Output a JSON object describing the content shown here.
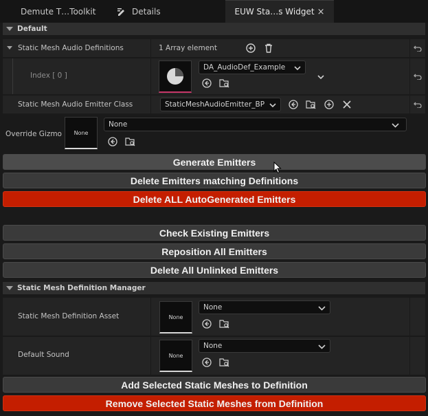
{
  "tabs": [
    {
      "label": "Demute T…Toolkit",
      "icon": "none"
    },
    {
      "label": "Details",
      "icon": "pencil-icon"
    },
    {
      "label": "EUW Sta…s Widget",
      "icon": "none",
      "close": "×"
    }
  ],
  "categories": {
    "default": "Default",
    "manager": "Static Mesh Definition Manager"
  },
  "props": {
    "audio_defs_label": "Static Mesh Audio Definitions",
    "audio_defs_value": "1 Array element",
    "index_label": "Index [ 0 ]",
    "index_value": "DA_AudioDef_Example",
    "emitter_class_label": "Static Mesh Audio Emitter Class",
    "emitter_class_value": "StaticMeshAudioEmitter_BP",
    "override_gizmo_label": "Override Gizmo",
    "override_gizmo_thumb": "None",
    "override_gizmo_value": "None",
    "def_asset_label": "Static Mesh Definition Asset",
    "def_asset_thumb": "None",
    "def_asset_value": "None",
    "default_sound_label": "Default Sound",
    "default_sound_thumb": "None",
    "default_sound_value": "None"
  },
  "buttons": {
    "generate": "Generate Emitters",
    "delete_matching": "Delete Emitters matching Definitions",
    "delete_all_auto": "Delete ALL AutoGenerated Emitters",
    "check": "Check Existing Emitters",
    "reposition": "Reposition All Emitters",
    "delete_unlinked": "Delete All Unlinked Emitters",
    "add_selected": "Add Selected Static Meshes to Definition",
    "remove_selected": "Remove Selected Static Meshes from Definition"
  },
  "colors": {
    "danger": "#c41e00",
    "button": "#3a3a3a",
    "accent_pink": "#c8376a"
  }
}
